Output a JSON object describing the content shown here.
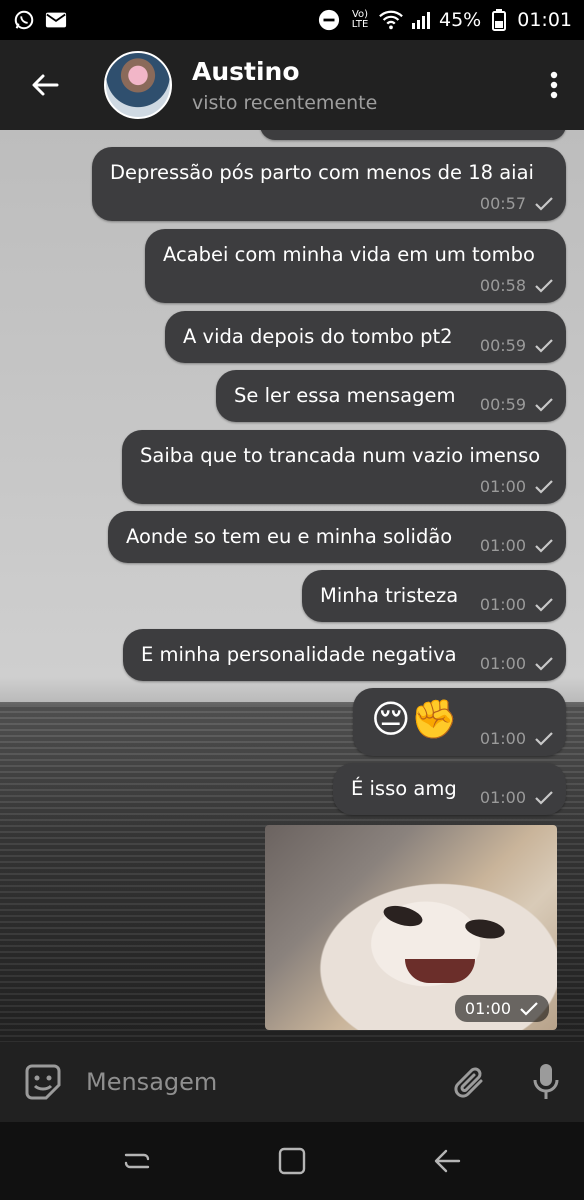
{
  "status_bar": {
    "battery": "45%",
    "time": "01:01",
    "network_label": "Vo) LTE",
    "icons": [
      "whatsapp-icon",
      "mail-icon",
      "dnd-icon",
      "volte-icon",
      "wifi-icon",
      "signal-icon",
      "battery-icon"
    ]
  },
  "header": {
    "contact_name": "Austino",
    "status": "visto recentemente",
    "icons": [
      "back-arrow-icon",
      "avatar",
      "more-vert-icon"
    ]
  },
  "messages": [
    {
      "text": "Depressão pós parto com menos de 18 aiai",
      "time": "00:57",
      "status": "sent"
    },
    {
      "text": "Acabei com minha vida em um tombo",
      "time": "00:58",
      "status": "sent"
    },
    {
      "text": "A vida depois do tombo pt2",
      "time": "00:59",
      "status": "sent"
    },
    {
      "text": "Se ler essa mensagem",
      "time": "00:59",
      "status": "sent"
    },
    {
      "text": "Saiba que to trancada num vazio imenso",
      "time": "01:00",
      "status": "sent"
    },
    {
      "text": "Aonde so tem eu e minha solidão",
      "time": "01:00",
      "status": "sent"
    },
    {
      "text": "Minha tristeza",
      "time": "01:00",
      "status": "sent"
    },
    {
      "text": "E minha personalidade negativa",
      "time": "01:00",
      "status": "sent"
    },
    {
      "text": "😔✊",
      "time": "01:00",
      "status": "sent"
    },
    {
      "text": "É isso amg",
      "time": "01:00",
      "status": "sent"
    }
  ],
  "sticker": {
    "time": "01:00",
    "status": "sent"
  },
  "input_bar": {
    "placeholder": "Mensagem",
    "icons": [
      "sticker-emoji-icon",
      "attach-icon",
      "mic-icon"
    ]
  },
  "nav_bar": {
    "icons": [
      "recent-apps-icon",
      "home-icon",
      "back-icon"
    ]
  },
  "colors": {
    "header_bg": "#212121",
    "bubble_bg": "#3d3d3f",
    "meta_text": "#9b9b9b",
    "subtitle": "#9e9e9e"
  }
}
